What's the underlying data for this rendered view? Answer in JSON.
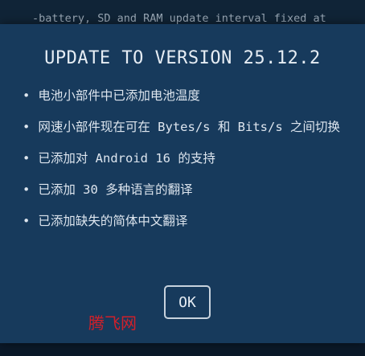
{
  "background": {
    "changelog_text": "-battery, SD and RAM update interval fixed at"
  },
  "dialog": {
    "title": "UPDATE TO VERSION 25.12.2",
    "bullet": "•",
    "items": [
      "电池小部件中已添加电池温度",
      "网速小部件现在可在 Bytes/s 和 Bits/s 之间切换",
      "已添加对 Android 16 的支持",
      "已添加 30 多种语言的翻译",
      "已添加缺失的简体中文翻译"
    ],
    "ok_label": "OK"
  },
  "watermark": {
    "text": "腾飞网"
  },
  "colors": {
    "dialog_background": "#173a5c",
    "page_background": "#0f2236",
    "text": "#dde5ee",
    "watermark": "#d0202a"
  }
}
